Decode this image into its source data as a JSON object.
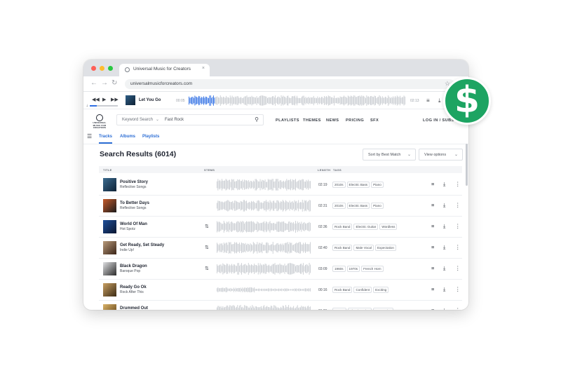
{
  "browser": {
    "tab_title": "Universal Music for Creators",
    "tab_close": "×",
    "url": "universalmusicforcreators.com"
  },
  "player": {
    "track_title": "Let You Go",
    "elapsed": "00:05",
    "duration": "02:13",
    "progress": 0.24
  },
  "site": {
    "logo_text": "UNIVERSAL MUSIC FOR CREATORS",
    "search": {
      "type_label": "Keyword Search",
      "query": "Fast Rock"
    },
    "nav": [
      "PLAYLISTS",
      "THEMES",
      "NEWS",
      "PRICING",
      "SFX"
    ],
    "auth": "LOG IN / SUBSCRIBE"
  },
  "tabs": [
    "Tracks",
    "Albums",
    "Playlists"
  ],
  "active_tab": "Tracks",
  "results_title": "Search Results (6014)",
  "sort": "Sort by Best Match",
  "view": "View options",
  "columns": {
    "title": "TITLE",
    "stems": "STEMS",
    "length": "LENGTH",
    "tags": "TAGS"
  },
  "tracks": [
    {
      "title": "Positive Story",
      "album": "Reflective Songs",
      "length": "02:19",
      "tags": [
        "2010s",
        "Electric Bass",
        "Piano"
      ],
      "stems": false
    },
    {
      "title": "To Better Days",
      "album": "Reflective Songs",
      "length": "02:31",
      "tags": [
        "2010s",
        "Electric Bass",
        "Piano"
      ],
      "stems": false
    },
    {
      "title": "World Of Man",
      "album": "Hot Spotz",
      "length": "02:36",
      "tags": [
        "Rock Band",
        "Electric Guitar",
        "Wordless"
      ],
      "stems": true
    },
    {
      "title": "Get Ready, Set Steady",
      "album": "Indie Up!",
      "length": "02:40",
      "tags": [
        "Rock Band",
        "Male Vocal",
        "Expectation"
      ],
      "stems": true
    },
    {
      "title": "Black Dragon",
      "album": "Baroque Pop",
      "length": "03:09",
      "tags": [
        "1960s",
        "1970s",
        "French Horn"
      ],
      "stems": true
    },
    {
      "title": "Ready Go Ok",
      "album": "Rock After This",
      "length": "00:16",
      "tags": [
        "Rock Band",
        "Confident",
        "Exciting"
      ],
      "stems": false
    },
    {
      "title": "Drummed Out",
      "album": "",
      "length": "01:21",
      "tags": [
        "Drums",
        "Electric Guitar",
        "Aggressive"
      ],
      "stems": false
    }
  ],
  "badge": "$",
  "colors": {
    "accent": "#2d6ed5",
    "badge_green": "#1da462"
  }
}
